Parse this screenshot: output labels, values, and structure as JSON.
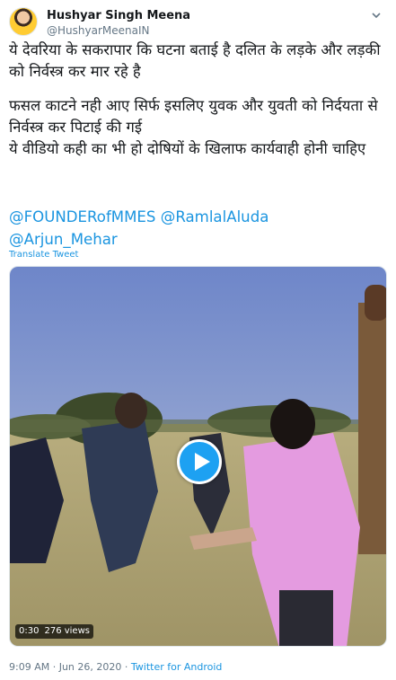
{
  "user": {
    "display_name": "Hushyar Singh Meena",
    "handle": "@HushyarMeenaIN"
  },
  "tweet": {
    "paragraph_1": "ये देवरिया के सकरापार कि घटना बताई है दलित के लड़के और लड़की को निर्वस्त्र कर मार रहे है",
    "paragraph_2": "फसल काटने नही आए सिर्फ इसलिए युवक और युवती को निर्दयता से निर्वस्त्र कर पिटाई की गई",
    "paragraph_3": "ये वीडियो कही का भी हो दोषियों के खिलाफ कार्यवाही होनी चाहिए",
    "mentions": [
      "@FOUNDERofMMES",
      "@RamlalAluda",
      "@Arjun_Mehar"
    ],
    "translate_label": "Translate Tweet"
  },
  "video": {
    "duration": "0:30",
    "views": "276 views"
  },
  "meta": {
    "timestamp": "9:09 AM · Jun 26, 2020",
    "separator": "·",
    "source": "Twitter for Android"
  },
  "icons": {
    "avatar": "avatar",
    "menu": "chevron-down-icon",
    "play": "play-icon"
  },
  "colors": {
    "link": "#1b95e0",
    "play_button": "#1da1f2",
    "secondary_text": "#657786"
  }
}
